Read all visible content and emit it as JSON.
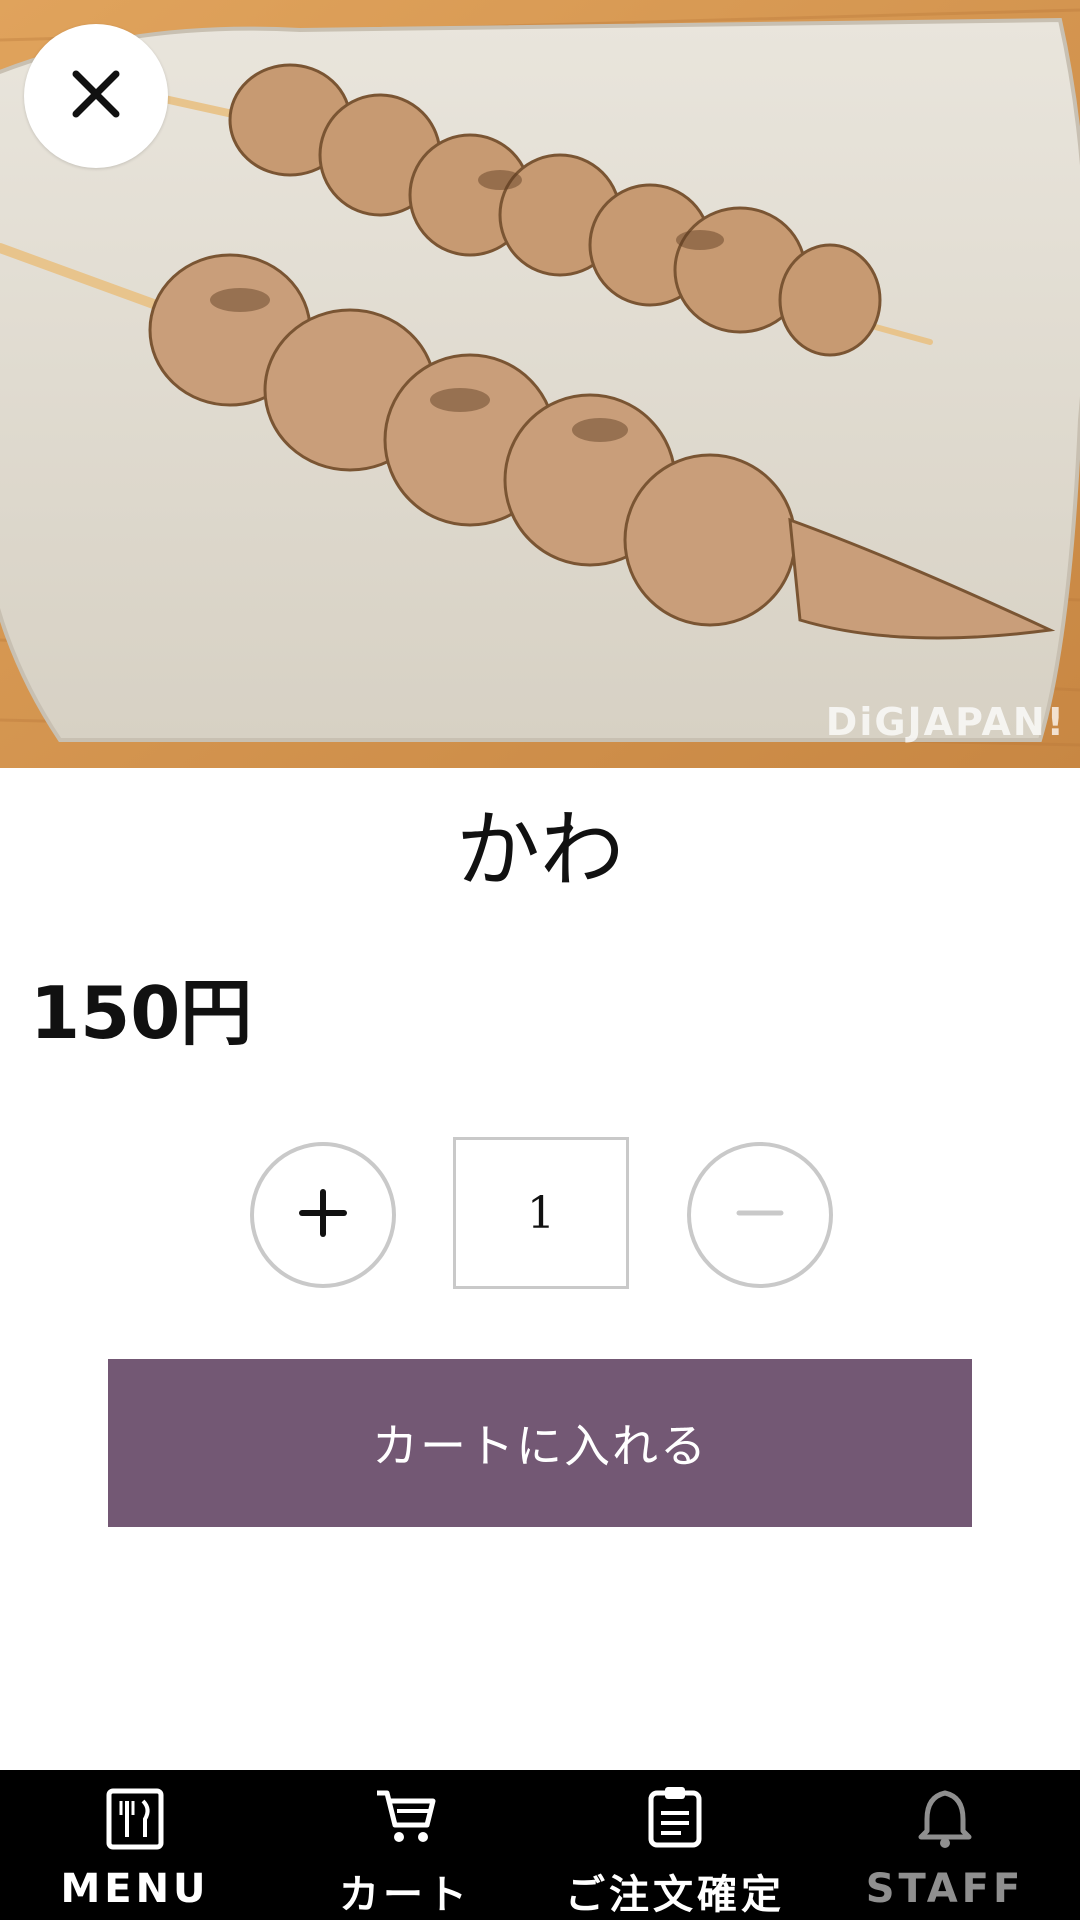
{
  "header": {
    "close_icon": "close-icon"
  },
  "hero": {
    "watermark": "DiGJAPAN!"
  },
  "item": {
    "name": "かわ",
    "price": "150円"
  },
  "quantity": {
    "value": "1",
    "plus_icon": "plus-icon",
    "minus_icon": "minus-icon"
  },
  "actions": {
    "add_to_cart": "カートに入れる"
  },
  "tabbar": {
    "items": [
      {
        "label": "MENU",
        "icon": "menu-icon"
      },
      {
        "label": "カート",
        "icon": "cart-icon"
      },
      {
        "label": "ご注文確定",
        "icon": "order-confirm-icon"
      },
      {
        "label": "STAFF",
        "icon": "bell-icon"
      }
    ]
  },
  "colors": {
    "accent": "#735874",
    "tabbar_bg": "#000000",
    "disabled": "#8f8f8f"
  }
}
